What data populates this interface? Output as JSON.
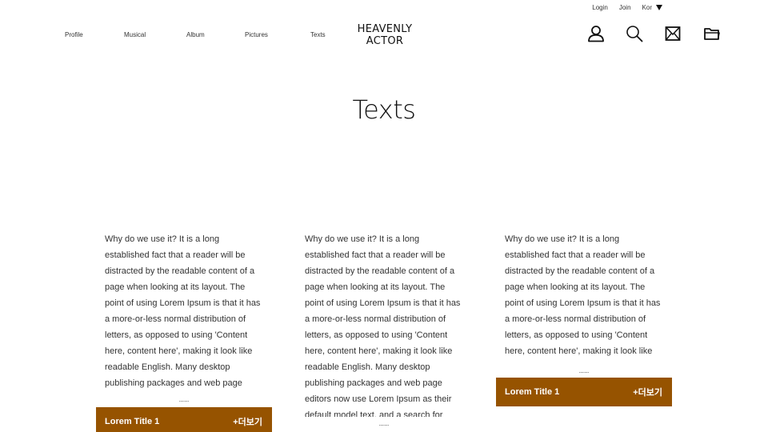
{
  "utility": {
    "login": "Login",
    "join": "Join",
    "lang": "Kor"
  },
  "nav": {
    "items": [
      "Profile",
      "Musical",
      "Album",
      "Pictures",
      "Texts"
    ]
  },
  "logo": {
    "line1": "HEAVENLY",
    "line2": "ACTOR"
  },
  "icons": [
    "user-icon",
    "search-icon",
    "mail-icon",
    "folder-icon"
  ],
  "page": {
    "title": "Texts"
  },
  "posts": [
    {
      "text": "Why do we use it? It is a long established fact that a reader will be distracted by the readable content of a page when looking at its layout. The point of using Lorem Ipsum is that it has a more-or-less normal distribution of letters, as opposed to using 'Content here, content here', making it look like readable English. Many desktop publishing packages and web page editors now use Lorem Ipsum as their default",
      "ellipsis": ".....",
      "title": "Lorem Title 1",
      "more": "+더보기"
    },
    {
      "text": "Why do we use it? It is a long established fact that a reader will be distracted by the readable content of a page when looking at its layout. The point of using Lorem Ipsum is that it has a more-or-less normal distribution of letters, as opposed to using 'Content here, content here', making it look like readable English. Many desktop publishing packages and web page editors now use Lorem Ipsum as their default model text, and a search for 'lorem ipsum' will uncover many web sites still in their",
      "ellipsis": "....."
    },
    {
      "text": "Why do we use it? It is a long established fact that a reader will be distracted by the readable content of a page when looking at its layout. The point of using Lorem Ipsum is that it has a more-or-less normal distribution of letters, as opposed to using 'Content here, content here', making it look like readable English. Many desktop",
      "ellipsis": ".....",
      "title": "Lorem Title 1",
      "more": "+더보기"
    }
  ],
  "colors": {
    "accent": "#965300",
    "text": "#333333",
    "background": "#ffffff"
  }
}
